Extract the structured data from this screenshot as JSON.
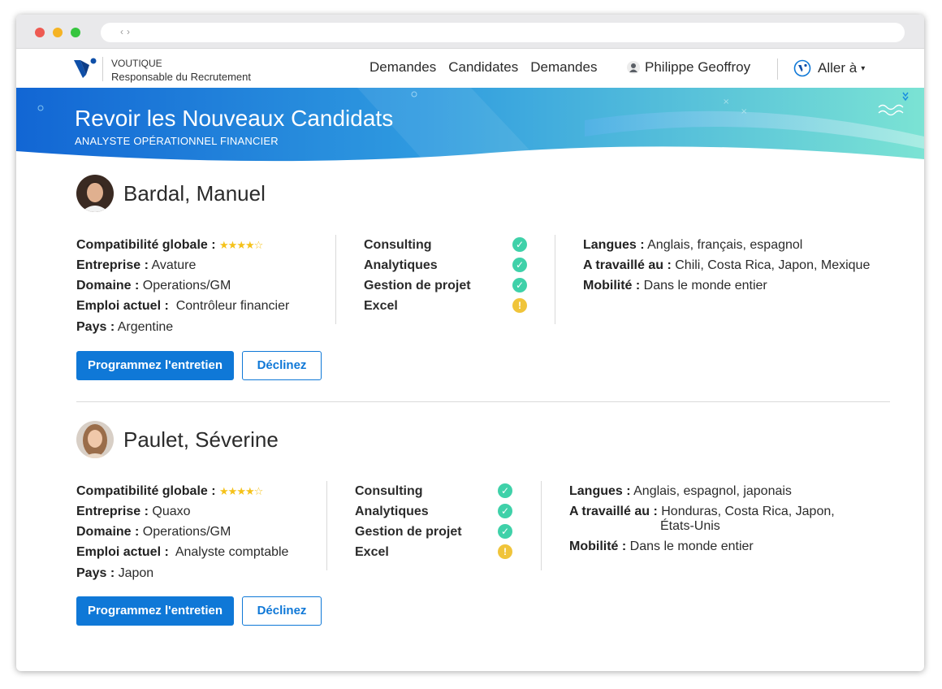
{
  "header": {
    "org_name": "VOUTIQUE",
    "org_role": "Responsable du Recrutement",
    "nav": [
      "Demandes",
      "Candidates",
      "Demandes"
    ],
    "user_name": "Philippe Geoffroy",
    "goto_label": "Aller à"
  },
  "banner": {
    "title": "Revoir les Nouveaux Candidats",
    "subtitle": "ANALYSTE OPÉRATIONNEL FINANCIER"
  },
  "colors": {
    "primary": "#0f78d7",
    "ok": "#3fd1a9",
    "warn": "#f0c43a",
    "star": "#f5c21a"
  },
  "candidates": [
    {
      "name": "Bardal, Manuel",
      "labels": {
        "compat": "Compatibilité globale :",
        "company": "Entreprise :",
        "domain": "Domaine :",
        "job": "Emploi actuel :",
        "country": "Pays :",
        "languages": "Langues :",
        "worked": "A travaillé au :",
        "mobility": "Mobilité :"
      },
      "stars": "★★★★☆",
      "rating": 4,
      "company": "Avature",
      "domain": "Operations/GM",
      "job": "Contrôleur financier",
      "country": "Argentine",
      "skills": [
        {
          "name": "Consulting",
          "status": "ok"
        },
        {
          "name": "Analytiques",
          "status": "ok"
        },
        {
          "name": "Gestion de projet",
          "status": "ok"
        },
        {
          "name": "Excel",
          "status": "warn"
        }
      ],
      "languages": "Anglais, français, espagnol",
      "worked": "Chili, Costa Rica, Japon, Mexique",
      "worked_line2": "",
      "mobility": "Dans le monde entier",
      "schedule_label": "Programmez l'entretien",
      "decline_label": "Déclinez"
    },
    {
      "name": "Paulet, Séverine",
      "labels": {
        "compat": "Compatibilité globale :",
        "company": "Entreprise :",
        "domain": "Domaine :",
        "job": "Emploi actuel :",
        "country": "Pays :",
        "languages": "Langues :",
        "worked": "A travaillé au :",
        "mobility": "Mobilité :"
      },
      "stars": "★★★★☆",
      "rating": 4,
      "company": "Quaxo",
      "domain": "Operations/GM",
      "job": "Analyste comptable",
      "country": "Japon",
      "skills": [
        {
          "name": "Consulting",
          "status": "ok"
        },
        {
          "name": "Analytiques",
          "status": "ok"
        },
        {
          "name": "Gestion de projet",
          "status": "ok"
        },
        {
          "name": "Excel",
          "status": "warn"
        }
      ],
      "languages": "Anglais, espagnol, japonais",
      "worked": "Honduras, Costa Rica, Japon,",
      "worked_line2": "États-Unis",
      "mobility": "Dans le monde entier",
      "schedule_label": "Programmez l'entretien",
      "decline_label": "Déclinez"
    }
  ]
}
